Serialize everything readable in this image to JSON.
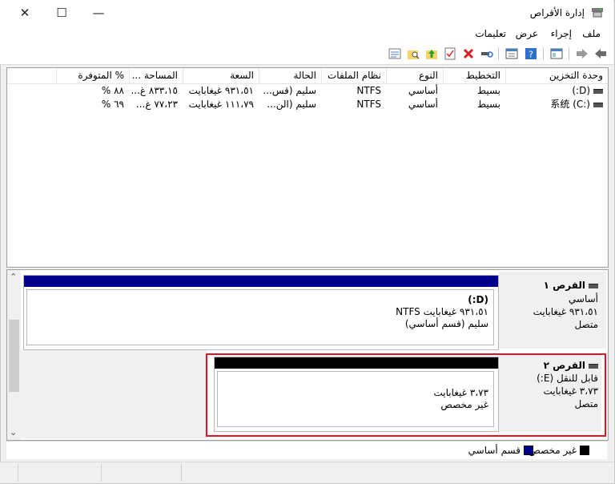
{
  "window": {
    "title": "إدارة الأقراص",
    "close_glyph": "✕",
    "maximize_glyph": "☐",
    "minimize_glyph": "—"
  },
  "menu": [
    {
      "label": "ملف"
    },
    {
      "label": "إجراء"
    },
    {
      "label": "عرض"
    },
    {
      "label": "تعليمات"
    }
  ],
  "volumes": {
    "columns": [
      "وحدة التخزين",
      "التخطيط",
      "النوع",
      "نظام الملفات",
      "الحالة",
      "السعة",
      "المساحة ...",
      "% المتوفرة"
    ],
    "rows": [
      {
        "volume": "(D:)",
        "layout": "بسيط",
        "type": "أساسي",
        "fs": "NTFS",
        "status": "سليم (قس...",
        "capacity": "٩٣١،٥١ غيغابايت",
        "free": "٨٣٣،١٥ غ...",
        "pct": "٨٨ %"
      },
      {
        "volume": "系统 (C:)",
        "layout": "بسيط",
        "type": "أساسي",
        "fs": "NTFS",
        "status": "سليم (الن...",
        "capacity": "١١١،٧٩ غيغابايت",
        "free": "٧٧،٢٣ غ...",
        "pct": "٦٩ %"
      }
    ]
  },
  "disks": [
    {
      "name": "القرص ١",
      "kind": "أساسي",
      "size": "٩٣١،٥١ غيغابايت",
      "state": "متصل",
      "partition": {
        "label": "(D:)",
        "line1": "٩٣١،٥١ غيغابايت NTFS",
        "line2": "سليم (قسم أساسي)",
        "bar_color": "#00008b"
      }
    },
    {
      "name": "القرص ٢",
      "kind": "قابل للنقل (E:)",
      "size": "٣،٧٣ غيغابايت",
      "state": "متصل",
      "partition": {
        "line1": "٣،٧٣ غيغابايت",
        "line2": "غير مخصص",
        "bar_color": "#000000"
      }
    }
  ],
  "legend": [
    {
      "label": "غير مخصص",
      "color": "#000000"
    },
    {
      "label": "قسم أساسي",
      "color": "#00008b"
    }
  ],
  "scroll": {
    "up_glyph": "⌃",
    "down_glyph": "⌄"
  },
  "colors": {
    "highlight": "#e81123"
  }
}
